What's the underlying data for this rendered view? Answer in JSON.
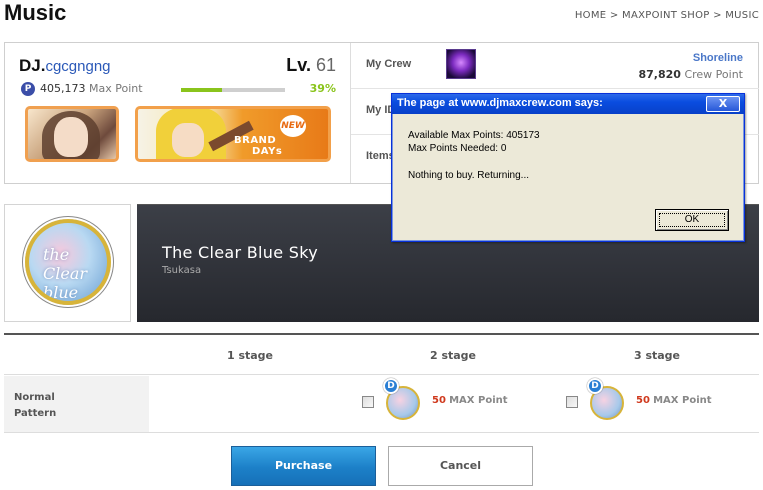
{
  "page": {
    "title": "Music",
    "breadcrumb": "HOME > MAXPOINT SHOP > MUSIC"
  },
  "profile": {
    "dj_prefix": "DJ.",
    "dj_name": "cgcgngng",
    "level_label": "Lv.",
    "level": "61",
    "max_point_value": "405,173",
    "max_point_label": "Max Point",
    "progress_percent_text": "39%",
    "progress_fraction": 0.39,
    "card2_brand": "BRAND",
    "card2_new": "NEW",
    "card2_days": "DAYs"
  },
  "crew": {
    "my_crew_label": "My Crew",
    "crew_name": "Shoreline",
    "crew_points_value": "87,820",
    "crew_points_label": "Crew Point",
    "my_id_label": "My ID",
    "items_label": "Items"
  },
  "song": {
    "title": "The Clear Blue Sky",
    "artist": "Tsukasa",
    "thumb_text": "the Clear blue"
  },
  "stages": {
    "headers": [
      "1 stage",
      "2 stage",
      "3 stage"
    ],
    "row_label": "Normal Pattern",
    "items": [
      {
        "badge": "D",
        "price": "50",
        "price_label": "MAX Point"
      },
      {
        "badge": "D",
        "price": "50",
        "price_label": "MAX Point"
      }
    ]
  },
  "buttons": {
    "purchase": "Purchase",
    "cancel": "Cancel"
  },
  "alert": {
    "title": "The page at www.djmaxcrew.com says:",
    "close": "X",
    "line1": "Available Max Points: 405173",
    "line2": "Max Points Needed: 0",
    "line3": "Nothing to buy.  Returning...",
    "ok": "OK"
  },
  "colors": {
    "accent_green": "#8ac41c",
    "link_blue": "#2b59b8",
    "price_red": "#d03a1e",
    "purchase_blue": "#1c80c8"
  }
}
